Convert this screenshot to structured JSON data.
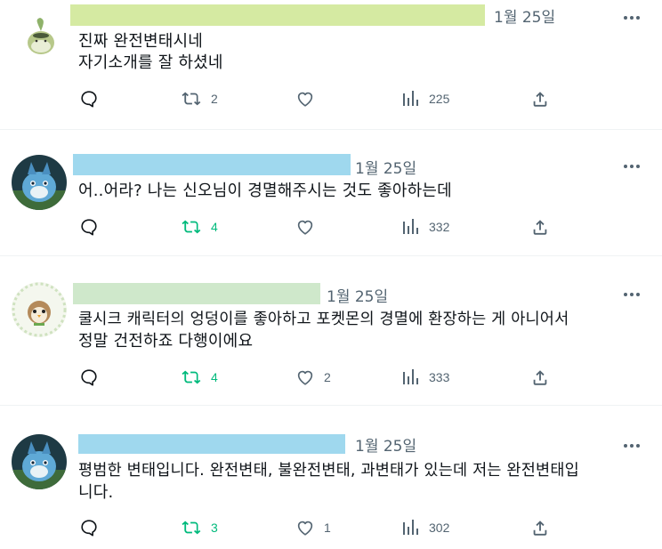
{
  "colors": {
    "text": "#0f1419",
    "muted": "#536471",
    "retweet_green": "#00ba7c",
    "redact_green": "#d5eaa2",
    "redact_blue": "#9fd8ee",
    "redact_lightgreen": "#cfe8cb"
  },
  "tweets": [
    {
      "date": "1월 25일",
      "lines": [
        "진짜 완전변태시네",
        "자기소개를 잘 하셨네"
      ],
      "reply_count": "",
      "retweet_count": "2",
      "like_count": "",
      "view_count": "225",
      "retweeted": false,
      "avatar_icon": "sprout-character-avatar-icon"
    },
    {
      "date": "1월 25일",
      "lines": [
        "어..어라? 나는 신오님이 경멸해주시는 것도 좋아하는데"
      ],
      "reply_count": "",
      "retweet_count": "4",
      "like_count": "",
      "view_count": "332",
      "retweeted": true,
      "avatar_icon": "blue-creature-avatar-icon"
    },
    {
      "date": "1월 25일",
      "lines": [
        "쿨시크 캐릭터의 엉덩이를 좋아하고 포켓몬의 경멸에 환장하는 게 아니어서",
        "정말 건전하죠 다행이에요"
      ],
      "reply_count": "",
      "retweet_count": "4",
      "like_count": "2",
      "view_count": "333",
      "retweeted": true,
      "avatar_icon": "owl-character-avatar-icon"
    },
    {
      "date": "1월 25일",
      "lines": [
        "평범한 변태입니다. 완전변태, 불완전변태, 과변태가 있는데 저는 완전변태입",
        "니다."
      ],
      "reply_count": "",
      "retweet_count": "3",
      "like_count": "1",
      "view_count": "302",
      "retweeted": true,
      "avatar_icon": "blue-creature-avatar-icon"
    }
  ]
}
